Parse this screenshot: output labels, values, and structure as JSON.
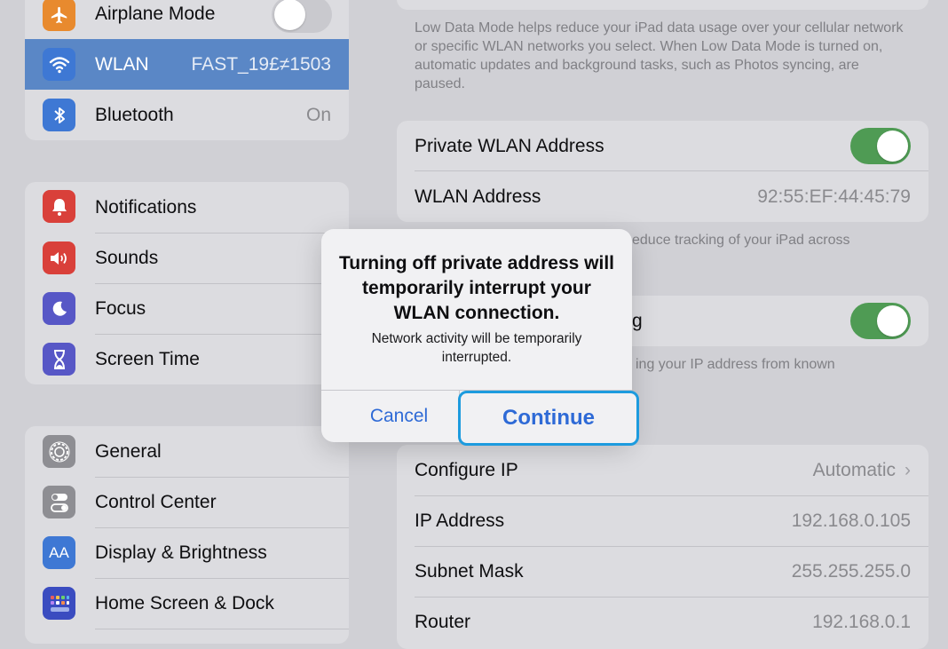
{
  "sidebar": {
    "group1": [
      {
        "label": "Airplane Mode",
        "icon": "airplane-icon",
        "toggle": "off"
      },
      {
        "label": "WLAN",
        "value": "FAST_19£≠1503",
        "icon": "wifi-icon",
        "selected": true
      },
      {
        "label": "Bluetooth",
        "value": "On",
        "icon": "bluetooth-icon"
      }
    ],
    "group2": [
      {
        "label": "Notifications",
        "icon": "bell-icon"
      },
      {
        "label": "Sounds",
        "icon": "speaker-icon"
      },
      {
        "label": "Focus",
        "icon": "moon-icon"
      },
      {
        "label": "Screen Time",
        "icon": "hourglass-icon"
      }
    ],
    "group3": [
      {
        "label": "General",
        "icon": "gear-icon"
      },
      {
        "label": "Control Center",
        "icon": "switches-icon"
      },
      {
        "label": "Display & Brightness",
        "icon": "text-size-icon",
        "icon_text": "AA"
      },
      {
        "label": "Home Screen & Dock",
        "icon": "grid-icon"
      }
    ]
  },
  "detail": {
    "low_data_footnote": "Low Data Mode helps reduce your iPad data usage over your cellular network or specific WLAN networks you select. When Low Data Mode is turned on, automatic updates and background tasks, such as Photos syncing, are paused.",
    "private_address": {
      "label": "Private WLAN Address",
      "toggle": "on"
    },
    "wlan_address": {
      "label": "WLAN Address",
      "value": "92:55:EF:44:45:79"
    },
    "private_footnote_visible": "educe tracking of your iPad across",
    "limit_tracking_label_visible": "g",
    "limit_tracking_toggle": "on",
    "limit_tracking_footnote_visible": "ing your IP address from known",
    "ip_section": [
      {
        "label": "Configure IP",
        "value": "Automatic",
        "chevron": "›"
      },
      {
        "label": "IP Address",
        "value": "192.168.0.105"
      },
      {
        "label": "Subnet Mask",
        "value": "255.255.255.0"
      },
      {
        "label": "Router",
        "value": "192.168.0.1"
      }
    ]
  },
  "dialog": {
    "title": "Turning off private address will temporarily interrupt your WLAN connection.",
    "message": "Network activity will be temporarily interrupted.",
    "cancel_label": "Cancel",
    "continue_label": "Continue"
  },
  "colors": {
    "selected_row": "#5a87c6",
    "toggle_on": "#4f9b54",
    "link_blue": "#2e6ad6",
    "focus_ring": "#1d9bde"
  }
}
